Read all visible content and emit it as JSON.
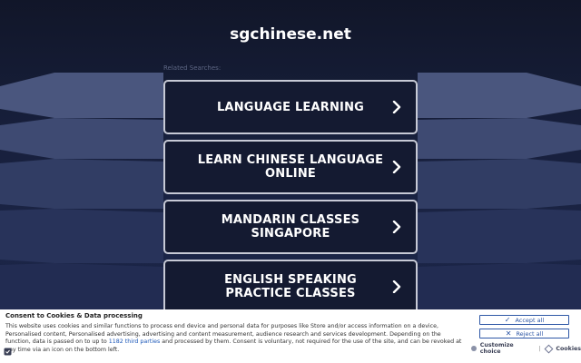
{
  "site": {
    "title": "sgchinese.net"
  },
  "related": {
    "label": "Related Searches:",
    "items": [
      {
        "label": "LANGUAGE LEARNING"
      },
      {
        "label": "LEARN CHINESE LANGUAGE ONLINE"
      },
      {
        "label": "MANDARIN CLASSES SINGAPORE"
      },
      {
        "label": "ENGLISH SPEAKING PRACTICE CLASSES"
      }
    ]
  },
  "consent": {
    "title": "Consent to Cookies & Data processing",
    "text_1": "This website uses cookies and similar functions to process end device and personal data for purposes like Store and/or access information on a device, Personalised content, Personalised advertising, advertising and content measurement, audience research and services development. Depending on the function, data is passed on to up to ",
    "link": "1182 third parties",
    "text_2": " and processed by them. Consent is voluntary, not required for the use of the site, and can be revoked at any time via an icon on the bottom left.",
    "accept_label": "Accept all",
    "reject_label": "Reject all",
    "customize_label": "Customize choice",
    "separator": "|",
    "cookies_label": "Cookies"
  },
  "colors": {
    "background": "#141a31",
    "button_border": "#c7cad6",
    "consent_accent": "#2e57a6"
  }
}
